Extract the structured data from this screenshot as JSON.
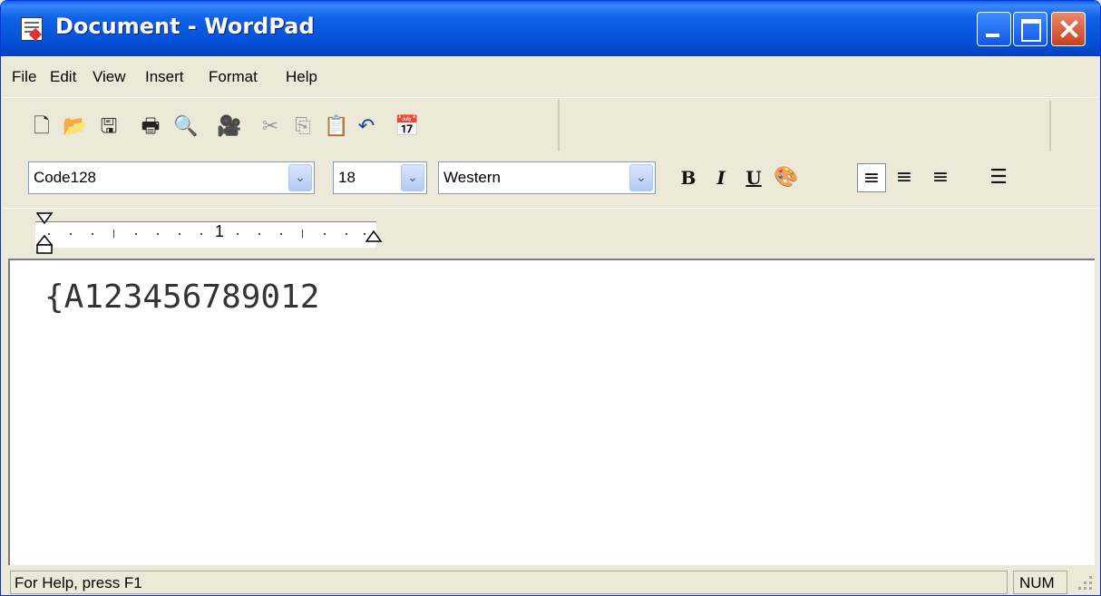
{
  "window": {
    "title": "Document - WordPad"
  },
  "menu": {
    "items": [
      "File",
      "Edit",
      "View",
      "Insert",
      "Format",
      "Help"
    ]
  },
  "toolbar": {
    "icons": [
      "new-icon",
      "open-icon",
      "save-icon",
      "print-icon",
      "print-preview-icon",
      "find-icon",
      "cut-icon",
      "copy-icon",
      "paste-icon",
      "undo-icon",
      "date-time-icon"
    ]
  },
  "format": {
    "font_name": "Code128",
    "font_size": "18",
    "script": "Western",
    "bold_label": "B",
    "italic_label": "I",
    "underline_label": "U",
    "alignment": "left"
  },
  "ruler": {
    "label": "1"
  },
  "document": {
    "text": "{A123456789012"
  },
  "status": {
    "help": "For Help, press F1",
    "num": "NUM"
  }
}
